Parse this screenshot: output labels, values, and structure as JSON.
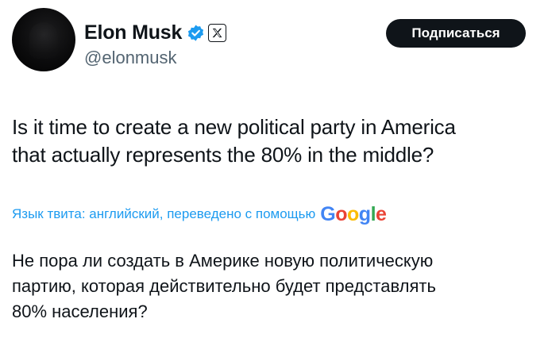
{
  "author": {
    "name": "Elon Musk",
    "handle": "@elonmusk",
    "verified_icon": "verified-badge-icon",
    "affiliate_icon": "x-logo-icon"
  },
  "actions": {
    "subscribe_label": "Подписаться"
  },
  "tweet": {
    "text": "Is it time to create a new political party in America\nthat actually represents the 80% in the middle?"
  },
  "translation": {
    "label": "Язык твита: английский, переведено с помощью",
    "provider": "Google",
    "text": "Не пора ли создать в Америке новую политическую\nпартию, которая действительно будет представлять\n80% населения?"
  },
  "colors": {
    "link": "#1d9bf0",
    "secondary_text": "#536471",
    "verified": "#1d9bf0",
    "button_bg": "#0f1419"
  }
}
